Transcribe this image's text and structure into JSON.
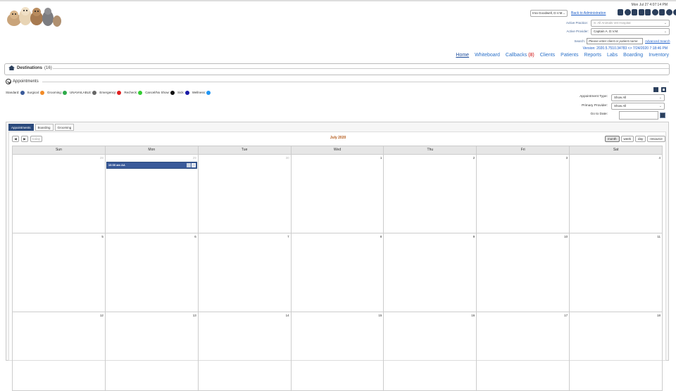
{
  "header": {
    "datetime": "Mon Jul 27 4:07:14 PM",
    "user": "Irna Goodwell, D.V.M.",
    "back_admin": "Back to Administration",
    "practice_label": "Active Practice:",
    "practice_value": "S: All Animals Vet Hospital",
    "provider_label": "Active Provider:",
    "provider_value": "Captain A. D.V.M.",
    "search_label": "Search:",
    "search_placeholder": "Please enter client or patient name",
    "advanced_search": "Advanced Search",
    "version": "Version: 2020.5.7510.34783 <> 7/24/2020 7:18:46 PM"
  },
  "nav": {
    "items": [
      {
        "label": "Home"
      },
      {
        "label": "Whiteboard"
      },
      {
        "label": "Callbacks",
        "count": "(8)"
      },
      {
        "label": "Clients"
      },
      {
        "label": "Patients"
      },
      {
        "label": "Reports"
      },
      {
        "label": "Labs"
      },
      {
        "label": "Boarding"
      },
      {
        "label": "Inventory"
      }
    ]
  },
  "destinations": {
    "label": "Destinations",
    "count": "(16)"
  },
  "appointments": {
    "title": "Appointments",
    "legend": [
      {
        "label": "Standard:",
        "color": "#3a5a9a"
      },
      {
        "label": "Surgical:",
        "color": "#f28c28"
      },
      {
        "label": "Grooming:",
        "color": "#2eaa4a"
      },
      {
        "label": "UNAVAILABLE:",
        "color": "#666666"
      },
      {
        "label": "Emergency:",
        "color": "#e02020"
      },
      {
        "label": "Recheck:",
        "color": "#33cc33"
      },
      {
        "label": "Cancel/No Show:",
        "color": "#111111"
      },
      {
        "label": "Sick:",
        "color": "#1a1aa6"
      },
      {
        "label": "Wellness:",
        "color": "#2196f3"
      }
    ],
    "filters": {
      "type_label": "Appointment Type:",
      "type_value": "Show All",
      "provider_label": "Primary Provider:",
      "provider_value": "Show All",
      "date_label": "Go to Date:"
    },
    "tabs": [
      "Appointments",
      "Boarding",
      "Grooming"
    ],
    "today": "today",
    "month_title": "July 2020",
    "views": [
      "month",
      "week",
      "day",
      "resource"
    ],
    "weekdays": [
      "Sun",
      "Mon",
      "Tue",
      "Wed",
      "Thu",
      "Fri",
      "Sat"
    ],
    "weeks": [
      [
        "28",
        "29",
        "30",
        "1",
        "2",
        "3",
        "4"
      ],
      [
        "5",
        "6",
        "7",
        "8",
        "9",
        "10",
        "11"
      ],
      [
        "12",
        "13",
        "14",
        "15",
        "16",
        "17",
        "18"
      ]
    ],
    "event": {
      "label": "10:00 am AA"
    }
  }
}
